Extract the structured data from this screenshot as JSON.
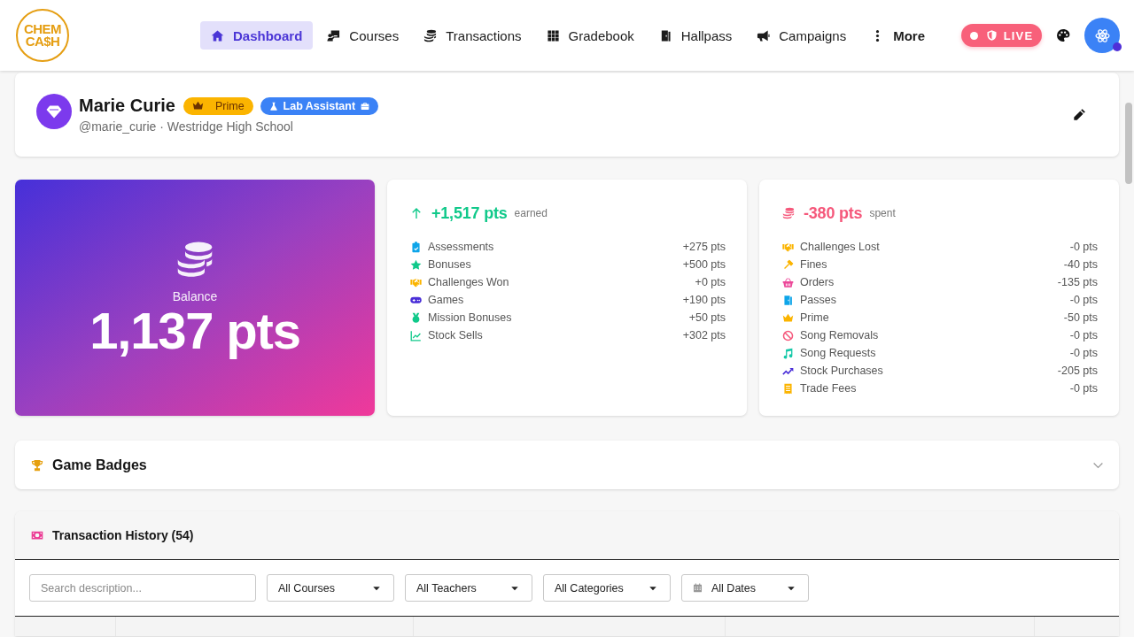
{
  "header": {
    "logo": {
      "lines": [
        "CHEM",
        "CA$H"
      ]
    },
    "nav": [
      {
        "label": "Dashboard",
        "kind": "link",
        "selected": true
      },
      {
        "label": "Courses",
        "kind": "link",
        "selected": false
      },
      {
        "label": "Transactions",
        "kind": "link",
        "selected": false
      },
      {
        "label": "Gradebook",
        "kind": "link",
        "selected": false
      },
      {
        "label": "Hallpass",
        "kind": "link",
        "selected": false
      },
      {
        "label": "Campaigns",
        "kind": "link",
        "selected": false
      },
      {
        "label": "More",
        "kind": "menu",
        "selected": false
      }
    ],
    "live_badge": {
      "label": "LIVE"
    }
  },
  "profile": {
    "name": "Marie Curie",
    "badges": [
      {
        "label": "Prime",
        "kind": "prime",
        "color": "#fbb400"
      },
      {
        "label": "Lab Assistant",
        "kind": "role",
        "color": "#3b82f6"
      }
    ],
    "subtitle": "@marie_curie · Westridge High School"
  },
  "balance": {
    "label": "Balance",
    "value": "1,137 pts"
  },
  "earned": {
    "total": "+1,517 pts",
    "caption": "earned",
    "rows": [
      {
        "label": "Assessments",
        "value": "+275 pts"
      },
      {
        "label": "Bonuses",
        "value": "+500 pts"
      },
      {
        "label": "Challenges Won",
        "value": "+0 pts"
      },
      {
        "label": "Games",
        "value": "+190 pts"
      },
      {
        "label": "Mission Bonuses",
        "value": "+50 pts"
      },
      {
        "label": "Stock Sells",
        "value": "+302 pts"
      }
    ]
  },
  "spent": {
    "total": "-380 pts",
    "caption": "spent",
    "rows": [
      {
        "label": "Challenges Lost",
        "value": "-0 pts"
      },
      {
        "label": "Fines",
        "value": "-40 pts"
      },
      {
        "label": "Orders",
        "value": "-135 pts"
      },
      {
        "label": "Passes",
        "value": "-0 pts"
      },
      {
        "label": "Prime",
        "value": "-50 pts"
      },
      {
        "label": "Song Removals",
        "value": "-0 pts"
      },
      {
        "label": "Song Requests",
        "value": "-0 pts"
      },
      {
        "label": "Stock Purchases",
        "value": "-205 pts"
      },
      {
        "label": "Trade Fees",
        "value": "-0 pts"
      }
    ]
  },
  "game_badges": {
    "title": "Game Badges",
    "expanded": false
  },
  "transaction_history": {
    "title": "Transaction History (54)",
    "search": {
      "placeholder": "Search description..."
    },
    "filters": [
      {
        "label": "All Courses",
        "kind": "select"
      },
      {
        "label": "All Teachers",
        "kind": "select"
      },
      {
        "label": "All Categories",
        "kind": "select"
      },
      {
        "label": "All Dates",
        "kind": "date"
      }
    ]
  }
}
